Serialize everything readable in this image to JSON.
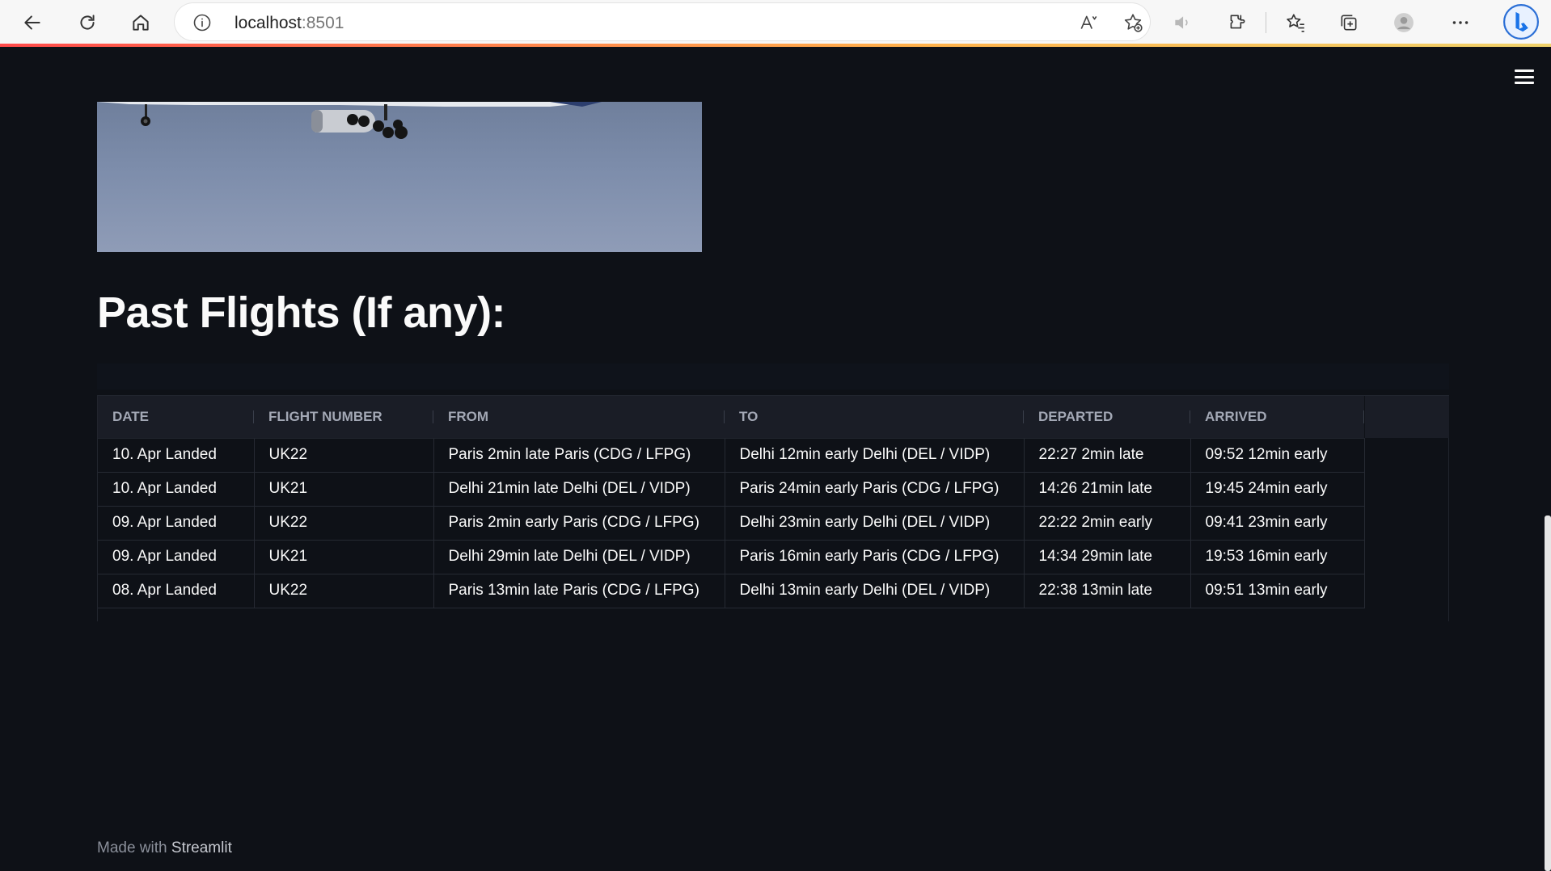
{
  "browser": {
    "url_host": "localhost",
    "url_port": ":8501",
    "icons": [
      "back-icon",
      "refresh-icon",
      "home-icon",
      "info-icon",
      "read-aloud-icon",
      "add-favorite-icon",
      "speaker-icon",
      "extensions-icon",
      "favorites-icon",
      "collections-icon",
      "profile-icon",
      "more-icon",
      "bing-icon"
    ]
  },
  "app": {
    "heading": "Past Flights (If any):",
    "table": {
      "columns": [
        "DATE",
        "FLIGHT NUMBER",
        "FROM",
        "TO",
        "DEPARTED",
        "ARRIVED"
      ],
      "rows": [
        [
          "10. Apr Landed",
          "UK22",
          "Paris 2min late Paris (CDG / LFPG)",
          "Delhi 12min early Delhi (DEL / VIDP)",
          "22:27 2min late",
          "09:52 12min early"
        ],
        [
          "10. Apr Landed",
          "UK21",
          "Delhi 21min late Delhi (DEL / VIDP)",
          "Paris 24min early Paris (CDG / LFPG)",
          "14:26 21min late",
          "19:45 24min early"
        ],
        [
          "09. Apr Landed",
          "UK22",
          "Paris 2min early Paris (CDG / LFPG)",
          "Delhi 23min early Delhi (DEL / VIDP)",
          "22:22 2min early",
          "09:41 23min early"
        ],
        [
          "09. Apr Landed",
          "UK21",
          "Delhi 29min late Delhi (DEL / VIDP)",
          "Paris 16min early Paris (CDG / LFPG)",
          "14:34 29min late",
          "19:53 16min early"
        ],
        [
          "08. Apr Landed",
          "UK22",
          "Paris 13min late Paris (CDG / LFPG)",
          "Delhi 13min early Delhi (DEL / VIDP)",
          "22:38 13min late",
          "09:51 13min early"
        ]
      ]
    },
    "footer": {
      "prefix": "Made with",
      "brand": "Streamlit"
    },
    "menu_icon": "hamburger-menu-icon"
  },
  "colors": {
    "background": "#0e1117",
    "text": "#fafafa",
    "header_bg": "#1a1d26",
    "accent": "#ff4b4b"
  }
}
